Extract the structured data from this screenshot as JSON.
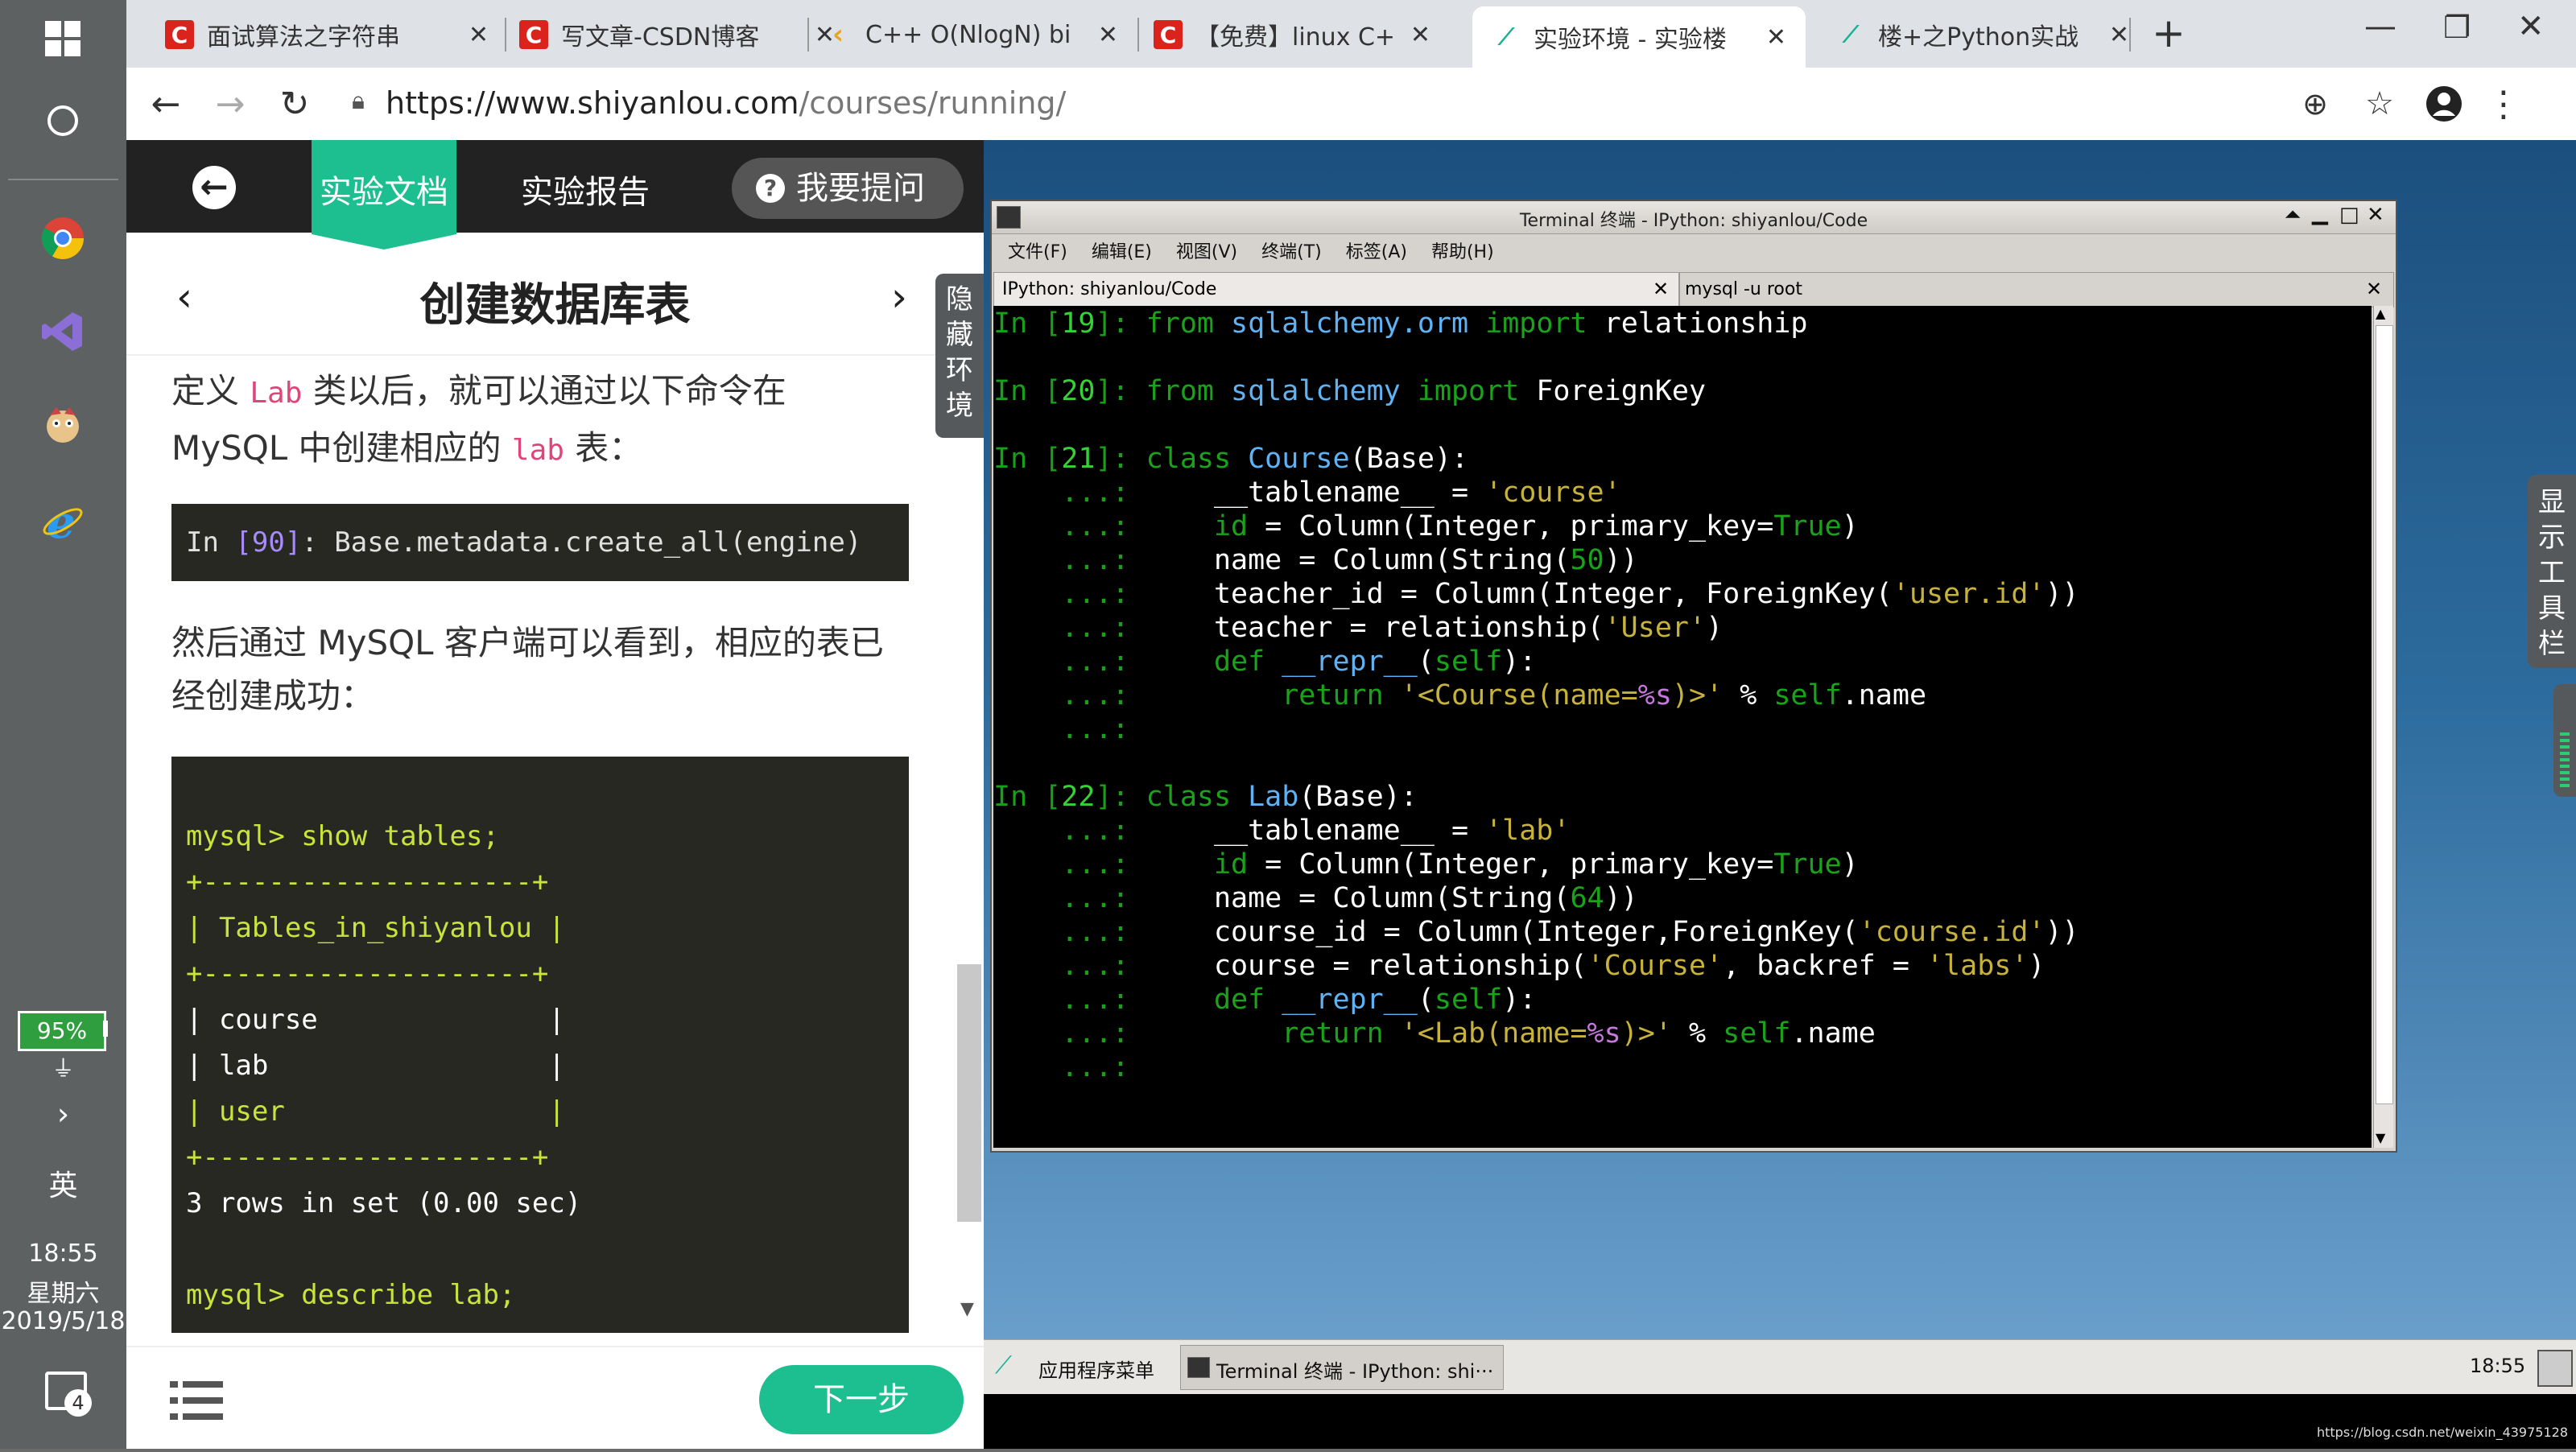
{
  "os_taskbar": {
    "battery": "95%",
    "ime": "英",
    "time": "18:55",
    "weekday": "星期六",
    "date": "2019/5/18",
    "notifications": "4"
  },
  "browser": {
    "tabs": [
      {
        "label": "面试算法之字符串",
        "icon": "csdn-icon"
      },
      {
        "label": "写文章-CSDN博客",
        "icon": "csdn-icon"
      },
      {
        "label": "C++ O(NlogN) bi",
        "icon": "leetcode-icon"
      },
      {
        "label": "【免费】linux C+",
        "icon": "csdn-icon"
      },
      {
        "label": "实验环境 - 实验楼",
        "icon": "shiyanlou-icon"
      },
      {
        "label": "楼+之Python实战",
        "icon": "shiyanlou-icon"
      }
    ],
    "url_base": "https://www.shiyanlou.com",
    "url_path": "/courses/running/",
    "new_tab": "+"
  },
  "doc": {
    "tab_doc": "实验文档",
    "tab_report": "实验报告",
    "tab_question": "我要提问",
    "title": "创建数据库表",
    "para1_a": "定义 ",
    "para1_code": "Lab",
    "para1_b": " 类以后，就可以通过以下命令在",
    "para1_c": "MySQL 中创建相应的 ",
    "para1_code2": "lab",
    "para1_d": " 表：",
    "code1_prompt": "In ",
    "code1_num": "[90]",
    "code1_rest": ": Base.metadata.create_all(engine)",
    "para2_a": "然后通过 MySQL 客户端可以看到，相应的表已",
    "para2_b": "经创建成功：",
    "mysql_lines": [
      "mysql> show tables;",
      "+--------------------+",
      "| Tables_in_shiyanlou |",
      "+--------------------+",
      "| course              |",
      "| lab                 |",
      "| user                |",
      "+--------------------+",
      "3 rows in set (0.00 sec)",
      "",
      "mysql> describe lab;"
    ],
    "hide_env": [
      "隐",
      "藏",
      "环",
      "境"
    ],
    "next_button": "下一步"
  },
  "remote": {
    "show_toolbar": [
      "显",
      "示",
      "工",
      "具",
      "栏"
    ],
    "terminal_title": "Terminal 终端 - IPython: shiyanlou/Code",
    "menu": [
      "文件(F)",
      "编辑(E)",
      "视图(V)",
      "终端(T)",
      "标签(A)",
      "帮助(H)"
    ],
    "term_tab1": "IPython: shiyanlou/Code",
    "term_tab2": "mysql -u root",
    "panel_menu": "应用程序菜单",
    "panel_task": "Terminal 终端 - IPython: shi···",
    "panel_clock": "18:55",
    "watermark": "https://blog.csdn.net/weixin_43975128"
  },
  "colors": {
    "accent_green": "#2ecc9a",
    "terminal_bg": "#000000",
    "desktop_blue": "#2d6c9e"
  }
}
